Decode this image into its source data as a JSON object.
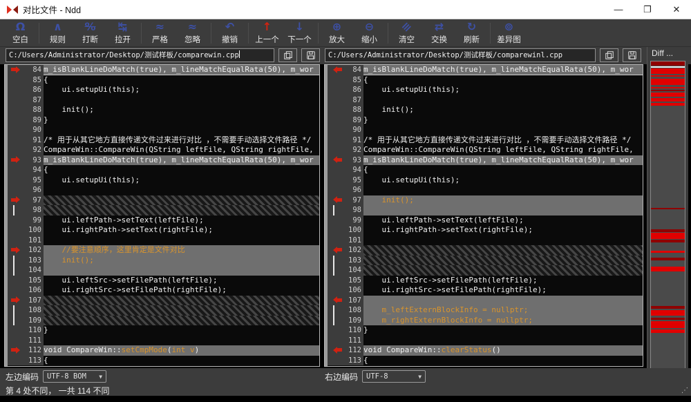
{
  "window": {
    "title": "对比文件 - Ndd",
    "controls": {
      "minimize": "—",
      "maximize": "❐",
      "close": "✕"
    }
  },
  "toolbar": {
    "groups": [
      [
        {
          "name": "blank",
          "glyph": "Ω",
          "label": "空白"
        }
      ],
      [
        {
          "name": "rules",
          "glyph": "∧",
          "label": "规则"
        },
        {
          "name": "break",
          "glyph": "%",
          "label": "打断",
          "strike": true
        },
        {
          "name": "pull-apart",
          "glyph": "↹",
          "label": "拉开"
        }
      ],
      [
        {
          "name": "strict",
          "glyph": "≈",
          "label": "严格"
        },
        {
          "name": "ignore",
          "glyph": "≈",
          "label": "忽略"
        }
      ],
      [
        {
          "name": "undo",
          "glyph": "↶",
          "label": "撤销"
        }
      ],
      [
        {
          "name": "previous-diff",
          "glyph": "↑",
          "label": "上一个",
          "red": true
        },
        {
          "name": "next-diff",
          "glyph": "↓",
          "label": "下一个"
        }
      ],
      [
        {
          "name": "zoom-in",
          "glyph": "⊕",
          "label": "放大"
        },
        {
          "name": "zoom-out",
          "glyph": "⊖",
          "label": "缩小"
        }
      ],
      [
        {
          "name": "clear",
          "glyph": "≡",
          "label": "清空",
          "rot": true
        },
        {
          "name": "swap",
          "glyph": "⇄",
          "label": "交换"
        },
        {
          "name": "refresh",
          "glyph": "↻",
          "label": "刷新"
        }
      ],
      [
        {
          "name": "diff-map",
          "glyph": "⊚",
          "label": "差异图"
        }
      ]
    ]
  },
  "paths": {
    "left": "C:/Users/Administrator/Desktop/测试样板/comparewin.cpp",
    "right": "C:/Users/Administrator/Desktop/测试样板/comparewinl.cpp"
  },
  "diff_panel": {
    "title": "Diff ...",
    "stripes": [
      [
        0,
        6,
        "d"
      ],
      [
        7,
        2,
        "w"
      ],
      [
        10,
        8,
        "r"
      ],
      [
        20,
        2,
        "r"
      ],
      [
        25,
        9,
        "r"
      ],
      [
        37,
        2,
        "r"
      ],
      [
        41,
        2,
        "d"
      ],
      [
        45,
        6,
        "r"
      ],
      [
        53,
        5,
        "r"
      ],
      [
        60,
        4,
        "r"
      ],
      [
        212,
        2,
        "d"
      ],
      [
        243,
        4,
        "d"
      ],
      [
        248,
        9,
        "r"
      ],
      [
        258,
        4,
        "d"
      ],
      [
        274,
        3,
        "r"
      ],
      [
        284,
        4,
        "d"
      ],
      [
        297,
        7,
        "r"
      ],
      [
        354,
        4,
        "d"
      ],
      [
        360,
        8,
        "r"
      ],
      [
        371,
        3,
        "d"
      ],
      [
        376,
        10,
        "r"
      ],
      [
        388,
        5,
        "r"
      ]
    ]
  },
  "encoding": {
    "left_label": "左边编码",
    "left_value": "UTF-8 BOM",
    "right_label": "右边编码",
    "right_value": "UTF-8"
  },
  "status": {
    "text": "第 4 处不同， 一共 114 不同"
  },
  "code": {
    "left": [
      {
        "n": 84,
        "bg": "sel",
        "mk": "arrow",
        "cur": true,
        "seg": [
          [
            "m_isBlankLineDoMatch(true), m_lineMatchEqualRata(50), m_wor",
            "w"
          ]
        ]
      },
      {
        "n": 85,
        "seg": [
          [
            "{",
            "w"
          ]
        ]
      },
      {
        "n": 86,
        "seg": [
          [
            "    ui.setupUi(this);",
            "w"
          ]
        ]
      },
      {
        "n": 87,
        "seg": []
      },
      {
        "n": 88,
        "seg": [
          [
            "    init();",
            "w"
          ]
        ]
      },
      {
        "n": 89,
        "seg": [
          [
            "}",
            "w"
          ]
        ]
      },
      {
        "n": 90,
        "seg": []
      },
      {
        "n": 91,
        "seg": [
          [
            "/* 用于从其它地方直接传递文件过来进行对比 ，不需要手动选择文件路径 */",
            "w"
          ]
        ]
      },
      {
        "n": 92,
        "seg": [
          [
            "CompareWin::CompareWin(QString leftFile, QString rightFile,",
            "w"
          ]
        ]
      },
      {
        "n": 93,
        "bg": "sel",
        "mk": "arrow",
        "seg": [
          [
            "m_isBlankLineDoMatch(true), m_lineMatchEqualRata(50), m_wor",
            "w"
          ]
        ]
      },
      {
        "n": 94,
        "seg": [
          [
            "{",
            "w"
          ]
        ]
      },
      {
        "n": 95,
        "seg": [
          [
            "    ui.setupUi(this);",
            "w"
          ]
        ]
      },
      {
        "n": 96,
        "seg": []
      },
      {
        "n": 97,
        "bg": "hatch",
        "mk": "arrow",
        "seg": []
      },
      {
        "n": 98,
        "bg": "hatch",
        "mk": "tick",
        "seg": []
      },
      {
        "n": 99,
        "seg": [
          [
            "    ui.leftPath->setText(leftFile);",
            "w"
          ]
        ]
      },
      {
        "n": 100,
        "seg": [
          [
            "    ui.rightPath->setText(rightFile);",
            "w"
          ]
        ]
      },
      {
        "n": 101,
        "seg": []
      },
      {
        "n": 102,
        "bg": "sel",
        "mk": "arrow",
        "seg": [
          [
            "    //要注意顺序，这里肯定是文件对比",
            "o"
          ]
        ]
      },
      {
        "n": 103,
        "bg": "sel",
        "mk": "tick",
        "seg": [
          [
            "    init();",
            "o"
          ]
        ]
      },
      {
        "n": 104,
        "bg": "sel",
        "mk": "tick",
        "seg": []
      },
      {
        "n": 105,
        "seg": [
          [
            "    ui.leftSrc->setFilePath(leftFile);",
            "w"
          ]
        ]
      },
      {
        "n": 106,
        "seg": [
          [
            "    ui.rightSrc->setFilePath(rightFile);",
            "w"
          ]
        ]
      },
      {
        "n": 107,
        "bg": "hatch",
        "mk": "arrow",
        "seg": []
      },
      {
        "n": 108,
        "bg": "hatch",
        "mk": "tick",
        "seg": []
      },
      {
        "n": 109,
        "bg": "hatch",
        "mk": "tick",
        "seg": []
      },
      {
        "n": 110,
        "seg": [
          [
            "}",
            "w"
          ]
        ]
      },
      {
        "n": 111,
        "seg": []
      },
      {
        "n": 112,
        "bg": "sel",
        "mk": "arrow",
        "seg": [
          [
            "void CompareWin::",
            "w"
          ],
          [
            "setCmpMode",
            "o"
          ],
          [
            "(",
            "w"
          ],
          [
            "int v",
            "o"
          ],
          [
            ")",
            "w"
          ]
        ]
      },
      {
        "n": 113,
        "seg": [
          [
            "{",
            "w"
          ]
        ]
      }
    ],
    "right": [
      {
        "n": 84,
        "bg": "sel",
        "mk": "arrow",
        "cur": true,
        "seg": [
          [
            "m_isBlankLineDoMatch(true), m_lineMatchEqualRata(50), m_wor",
            "w"
          ]
        ]
      },
      {
        "n": 85,
        "seg": [
          [
            "{",
            "w"
          ]
        ]
      },
      {
        "n": 86,
        "seg": [
          [
            "    ui.setupUi(this);",
            "w"
          ]
        ]
      },
      {
        "n": 87,
        "seg": []
      },
      {
        "n": 88,
        "seg": [
          [
            "    init();",
            "w"
          ]
        ]
      },
      {
        "n": 89,
        "seg": [
          [
            "}",
            "w"
          ]
        ]
      },
      {
        "n": 90,
        "seg": []
      },
      {
        "n": 91,
        "seg": [
          [
            "/* 用于从其它地方直接传递文件过来进行对比 ，不需要手动选择文件路径 */",
            "w"
          ]
        ]
      },
      {
        "n": 92,
        "seg": [
          [
            "CompareWin::CompareWin(QString leftFile, QString rightFile,",
            "w"
          ]
        ]
      },
      {
        "n": 93,
        "bg": "sel",
        "mk": "arrow",
        "seg": [
          [
            "m_isBlankLineDoMatch(true), m_lineMatchEqualRata(50), m_wor",
            "w"
          ]
        ]
      },
      {
        "n": 94,
        "seg": [
          [
            "{",
            "w"
          ]
        ]
      },
      {
        "n": 95,
        "seg": [
          [
            "    ui.setupUi(this);",
            "w"
          ]
        ]
      },
      {
        "n": 96,
        "seg": []
      },
      {
        "n": 97,
        "bg": "sel",
        "mk": "arrow",
        "seg": [
          [
            "    init();",
            "o"
          ]
        ]
      },
      {
        "n": 98,
        "bg": "sel",
        "mk": "tick",
        "seg": []
      },
      {
        "n": 99,
        "seg": [
          [
            "    ui.leftPath->setText(leftFile);",
            "w"
          ]
        ]
      },
      {
        "n": 100,
        "seg": [
          [
            "    ui.rightPath->setText(rightFile);",
            "w"
          ]
        ]
      },
      {
        "n": 101,
        "seg": []
      },
      {
        "n": 102,
        "bg": "hatch",
        "mk": "arrow",
        "seg": []
      },
      {
        "n": 103,
        "bg": "hatch",
        "mk": "tick",
        "seg": []
      },
      {
        "n": 104,
        "bg": "hatch",
        "mk": "tick",
        "seg": []
      },
      {
        "n": 105,
        "seg": [
          [
            "    ui.leftSrc->setFilePath(leftFile);",
            "w"
          ]
        ]
      },
      {
        "n": 106,
        "seg": [
          [
            "    ui.rightSrc->setFilePath(rightFile);",
            "w"
          ]
        ]
      },
      {
        "n": 107,
        "bg": "sel",
        "mk": "arrow",
        "seg": []
      },
      {
        "n": 108,
        "bg": "sel",
        "mk": "tick",
        "seg": [
          [
            "    m_leftExternBlockInfo = nullptr;",
            "o"
          ]
        ]
      },
      {
        "n": 109,
        "bg": "sel",
        "mk": "tick",
        "seg": [
          [
            "    m_rightExternBlockInfo = nullptr;",
            "o"
          ]
        ]
      },
      {
        "n": 110,
        "seg": [
          [
            "}",
            "w"
          ]
        ]
      },
      {
        "n": 111,
        "seg": []
      },
      {
        "n": 112,
        "bg": "sel",
        "mk": "arrow",
        "seg": [
          [
            "void CompareWin::",
            "w"
          ],
          [
            "clearStatus",
            "o"
          ],
          [
            "()",
            "w"
          ]
        ]
      },
      {
        "n": 113,
        "seg": [
          [
            "{",
            "w"
          ]
        ]
      }
    ]
  }
}
